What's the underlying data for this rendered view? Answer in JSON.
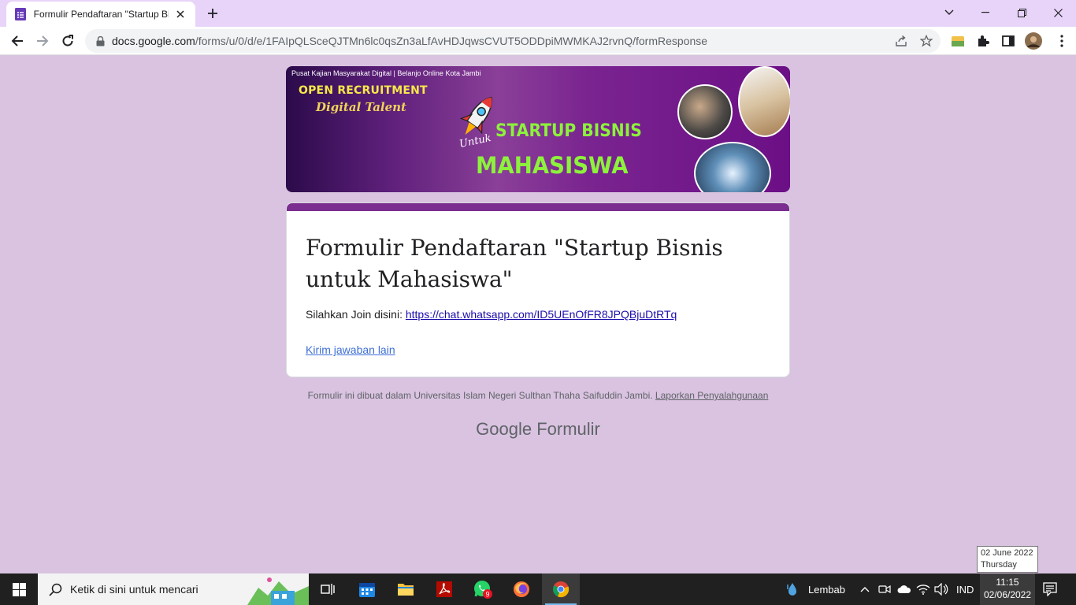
{
  "browser": {
    "tab_title": "Formulir Pendaftaran \"Startup Bis",
    "url_host": "docs.google.com",
    "url_path": "/forms/u/0/d/e/1FAIpQLSceQJTMn6lc0qsZn3aLfAvHDJqwsCVUT5ODDpiMWMKAJ2rvnQ/formResponse"
  },
  "banner": {
    "top_line": "Pusat Kajian Masyarakat Digital | Belanjo Online Kota Jambi",
    "open_recruitment": "OPEN RECRUITMENT",
    "digital_talent": "Digital Talent",
    "untuk": "Untuk",
    "startup": "STARTUP BISNIS",
    "mahasiswa": "MAHASISWA"
  },
  "form": {
    "title": "Formulir Pendaftaran \"Startup Bisnis untuk Mahasiswa\"",
    "message_prefix": "Silahkan Join disini: ",
    "whatsapp_link": "https://chat.whatsapp.com/ID5UEnOfFR8JPQBjuDtRTq",
    "another_response": "Kirim jawaban lain"
  },
  "footer": {
    "note": "Formulir ini dibuat dalam Universitas Islam Negeri Sulthan Thaha Saifuddin Jambi.",
    "report_link": "Laporkan Penyalahgunaan",
    "logo_google": "Google",
    "logo_forms": "Formulir"
  },
  "tooltip": {
    "date": "02 June 2022",
    "day": "Thursday"
  },
  "taskbar": {
    "search_placeholder": "Ketik di sini untuk mencari",
    "whatsapp_badge": "9",
    "weather": "Lembab",
    "language": "IND",
    "time": "11:15",
    "date": "02/06/2022"
  },
  "colors": {
    "page_bg": "#d9c3e0",
    "form_accent": "#7b2d90",
    "titlebar": "#e8d4f9"
  }
}
